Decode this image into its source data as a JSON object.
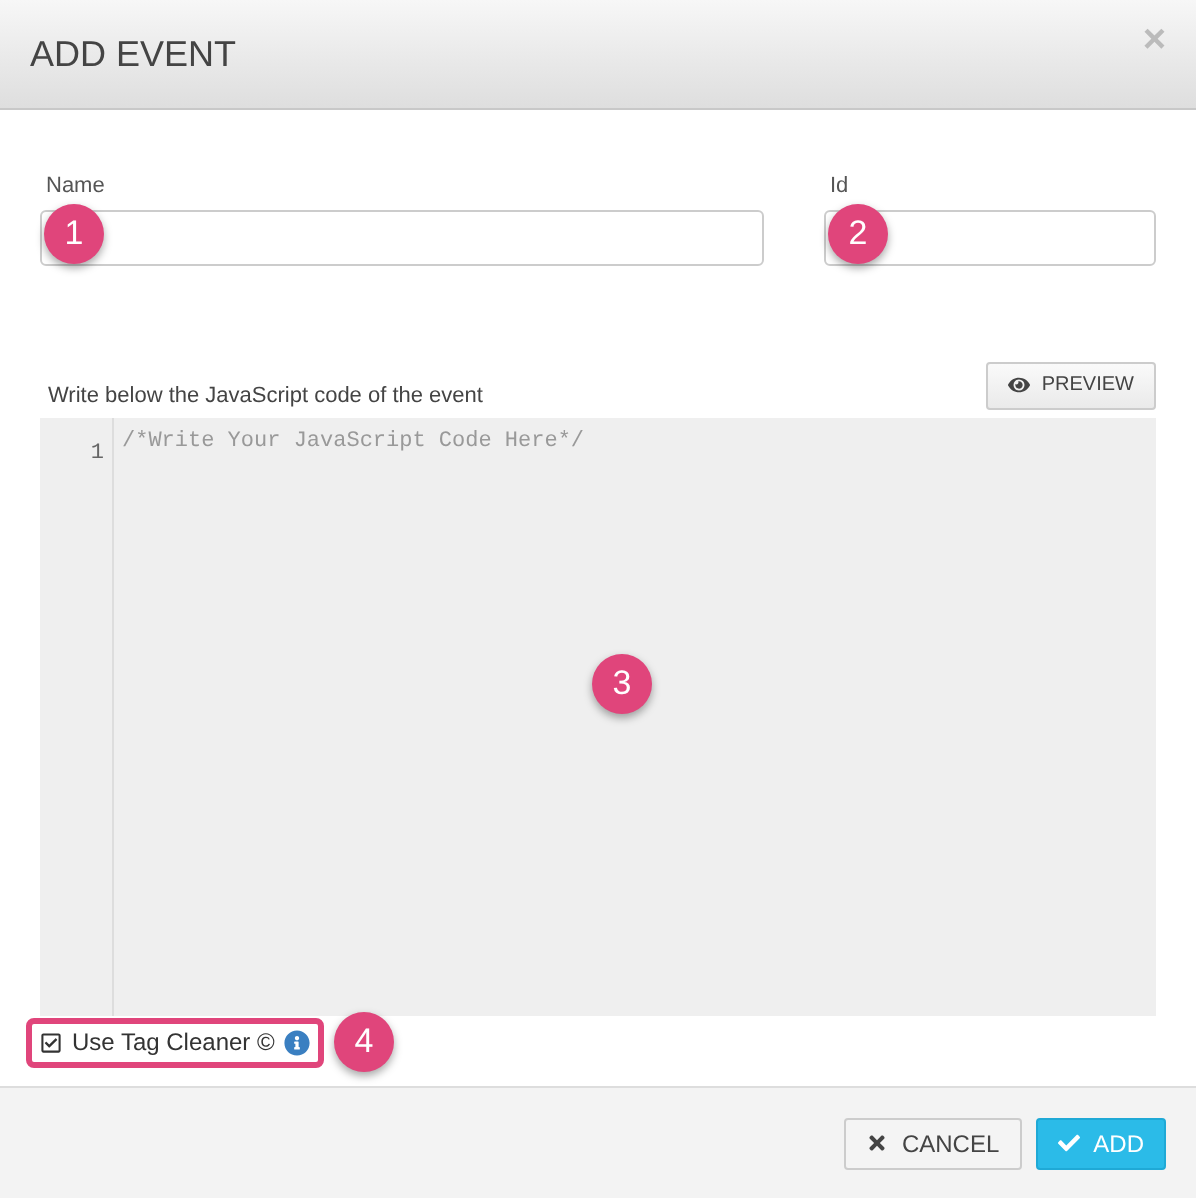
{
  "dialog": {
    "title": "ADD EVENT",
    "close": "×"
  },
  "fields": [
    {
      "label": "Name",
      "marker": "1"
    },
    {
      "label": "Id",
      "marker": "2"
    }
  ],
  "editor": {
    "label": "Write below the JavaScript code of the event",
    "preview_button": "PREVIEW",
    "line_number": "1",
    "placeholder": "/*Write Your JavaScript Code Here*/",
    "marker": "3"
  },
  "tag_cleaner": {
    "label": "Use Tag Cleaner ©",
    "checked": true,
    "marker": "4"
  },
  "buttons": [
    {
      "kind": "cancel",
      "label": "CANCEL"
    },
    {
      "kind": "add",
      "label": "ADD"
    }
  ]
}
